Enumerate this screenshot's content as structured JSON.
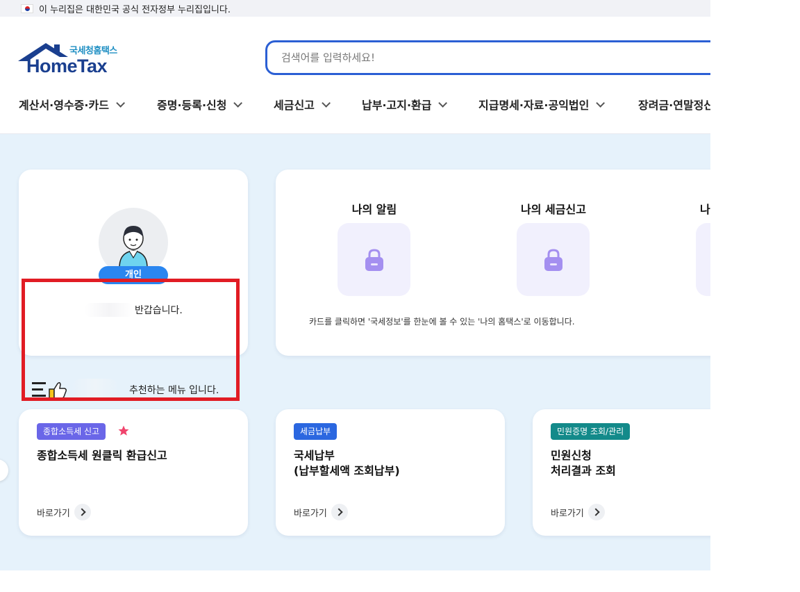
{
  "gov_banner": {
    "text": "이 누리집은 대한민국 공식 전자정부 누리집입니다.",
    "flag_icon": "korea-flag-icon"
  },
  "logo": {
    "sub": "국세청홈택스",
    "main": "HomeTax"
  },
  "search": {
    "placeholder": "검색어를 입력하세요!"
  },
  "gnb": [
    "계산서·영수증·카드",
    "증명·등록·신청",
    "세금신고",
    "납부·고지·환급",
    "지급명세·자료·공익법인",
    "장려금·연말정산"
  ],
  "profile": {
    "role": "개인",
    "greeting": "반갑습니다."
  },
  "notice": {
    "tiles": [
      {
        "title": "나의 알림"
      },
      {
        "title": "나의 세금신고"
      },
      {
        "title": "나의 세금납부"
      }
    ],
    "description": "카드를 클릭하면 '국세정보'를 한눈에 볼 수 있는 '나의 홈택스'로 이동합니다."
  },
  "recommend": {
    "text": "추천하는 메뉴 입니다."
  },
  "menu_cards": [
    {
      "badge": "종합소득세 신고",
      "badge_color": "#6a66e8",
      "title": "종합소득세 원클릭 환급신고",
      "goto": "바로가기",
      "starred": true
    },
    {
      "badge": "세금납부",
      "badge_color": "#2b67e0",
      "title": "국세납부\n(납부할세액 조회납부)",
      "goto": "바로가기",
      "starred": false
    },
    {
      "badge": "민원증명 조회/관리",
      "badge_color": "#138a8a",
      "title": "민원신청\n처리결과 조회",
      "goto": "바로가기",
      "starred": false
    }
  ],
  "colors": {
    "accent": "#2b5fd4",
    "highlight": "#e11c24",
    "lock": "#a48ff0"
  }
}
